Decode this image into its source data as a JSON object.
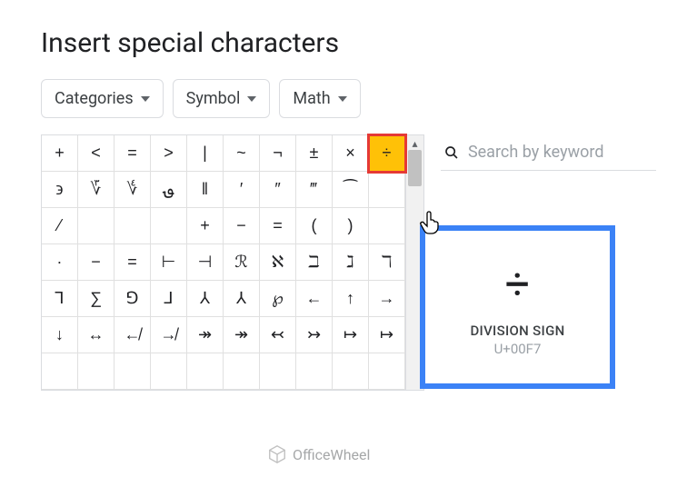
{
  "title": "Insert special characters",
  "filters": {
    "categories": "Categories",
    "type": "Symbol",
    "subtype": "Math"
  },
  "grid": {
    "rows": [
      [
        "+",
        "<",
        "=",
        ">",
        "|",
        "~",
        "¬",
        "±",
        "×",
        "÷"
      ],
      [
        "϶",
        "؆",
        "؇",
        "؈",
        "‖",
        "′",
        "″",
        "‴",
        "⁀",
        ""
      ],
      [
        "⁄",
        "",
        "",
        "",
        "+",
        "−",
        "=",
        "(",
        ")",
        ""
      ],
      [
        "∙",
        "−",
        "=",
        "⊢",
        "⊣",
        "ℛ",
        "ℵ",
        "ℶ",
        "ℷ",
        "ℸ"
      ],
      [
        "⅂",
        "∑",
        "⅁",
        "⅃",
        "⅄",
        "⅄",
        "℘",
        "←",
        "↑",
        "→"
      ],
      [
        "↓",
        "↔",
        "↚",
        "↛",
        "↠",
        "↠",
        "↢",
        "↣",
        "↦",
        "↦"
      ],
      [
        "",
        "",
        "",
        "",
        "",
        "",
        "",
        "",
        "",
        ""
      ]
    ],
    "highlight": {
      "row": 0,
      "col": 9
    }
  },
  "search": {
    "placeholder": "Search by keyword"
  },
  "tooltip": {
    "glyph": "÷",
    "name": "DIVISION SIGN",
    "code": "U+00F7"
  },
  "watermark": "OfficeWheel"
}
